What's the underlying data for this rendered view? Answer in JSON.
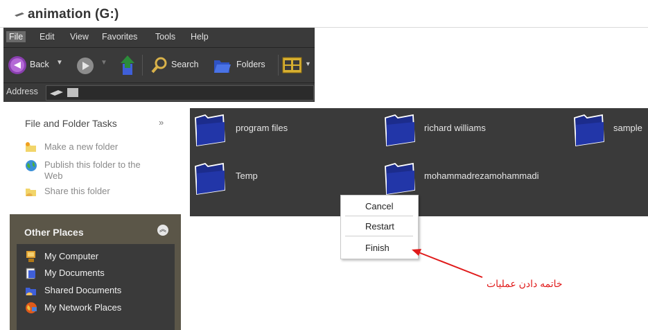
{
  "window": {
    "title": "animation (G:)"
  },
  "menubar": {
    "items": [
      "File",
      "Edit",
      "View",
      "Favorites",
      "Tools",
      "Help"
    ]
  },
  "toolbar": {
    "back_label": "Back",
    "search_label": "Search",
    "folders_label": "Folders"
  },
  "address": {
    "label": "Address"
  },
  "tasks": {
    "heading": "File and Folder Tasks",
    "collapse": "»",
    "items": [
      "Make a new folder",
      "Publish this folder to the Web",
      "Share this folder"
    ]
  },
  "other_places": {
    "heading": "Other Places",
    "items": [
      "My Computer",
      "My Documents",
      "Shared Documents",
      "My Network Places"
    ]
  },
  "folders": [
    "program files",
    "richard williams",
    "sample",
    "Temp",
    "mohammadrezamohammadi"
  ],
  "context_menu": {
    "items": [
      "Cancel",
      "Restart",
      "Finish"
    ]
  },
  "annotation": {
    "text": "خاتمه دادن عملیات",
    "color": "#e01a1a"
  },
  "colors": {
    "chrome": "#3a3a3a",
    "folder_blue": "#1c2c8c",
    "panel_tan": "#5b5648"
  }
}
